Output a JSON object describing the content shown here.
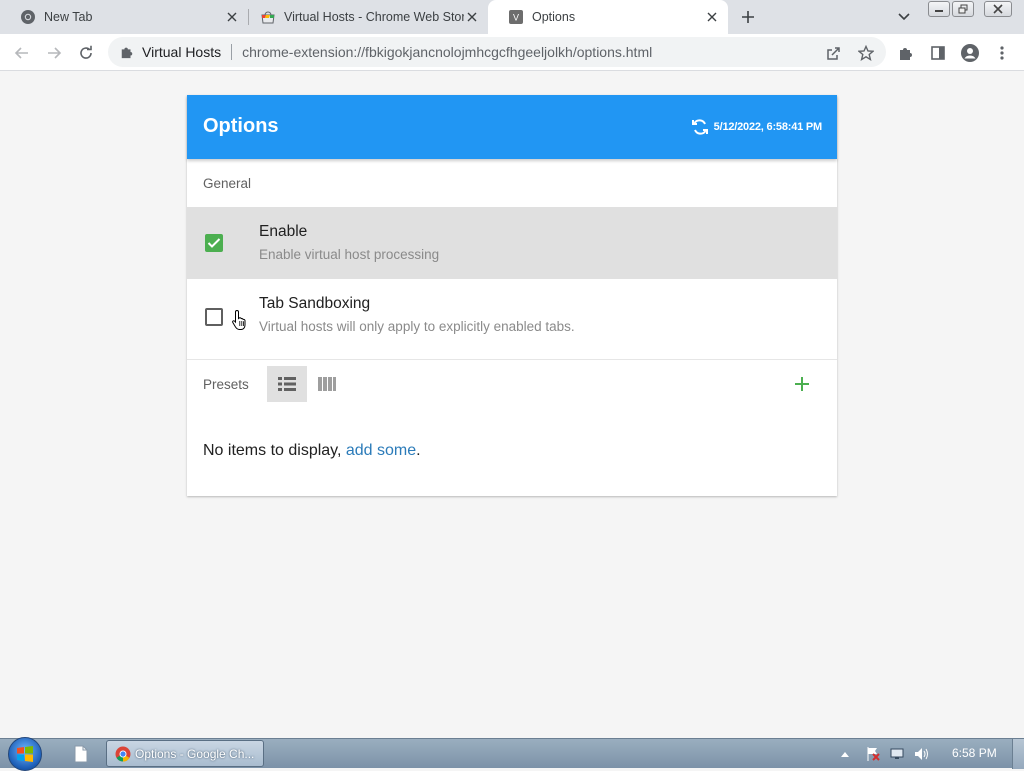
{
  "browser": {
    "tabs": [
      {
        "title": "New Tab",
        "active": false,
        "icon": "chrome-icon"
      },
      {
        "title": "Virtual Hosts - Chrome Web Store",
        "active": false,
        "icon": "webstore-icon"
      },
      {
        "title": "Options",
        "active": true,
        "icon": "extension-v-icon"
      }
    ],
    "favicon_letter": "V",
    "omnibox": {
      "site_label": "Virtual Hosts",
      "url": "chrome-extension://fbkigokjancnolojmhcgcfhgeeljolkh/options.html"
    }
  },
  "options_page": {
    "title": "Options",
    "sync_time": "5/12/2022, 6:58:41 PM",
    "header_color": "#2196f3",
    "section_general": "General",
    "options": [
      {
        "title": "Enable",
        "subtitle": "Enable virtual host processing",
        "checked": true
      },
      {
        "title": "Tab Sandboxing",
        "subtitle": "Virtual hosts will only apply to explicitly enabled tabs.",
        "checked": false
      }
    ],
    "presets_label": "Presets",
    "empty_text": "No items to display, ",
    "empty_link": "add some",
    "empty_suffix": ".",
    "accent_green": "#4caf50"
  },
  "taskbar": {
    "chrome_item": "Options - Google Ch...",
    "clock": "6:58 PM"
  }
}
